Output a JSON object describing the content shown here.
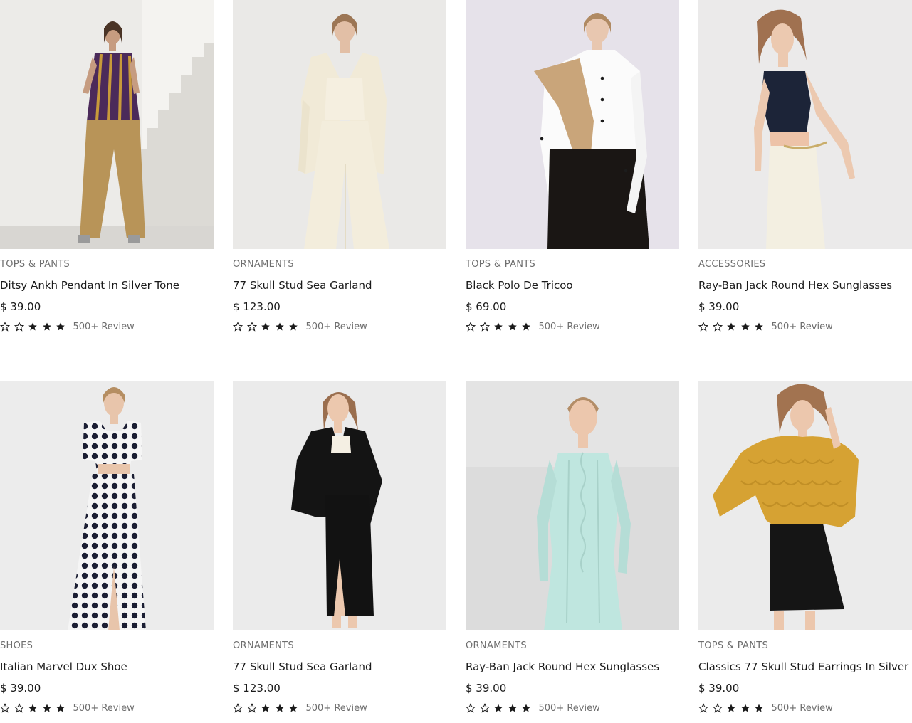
{
  "products": [
    {
      "category": "TOPS & PANTS",
      "title": "Ditsy Ankh Pendant In Silver Tone",
      "price": "$ 39.00",
      "review": "500+ Review",
      "rating": 3,
      "image": "woman-striped-top-gold-trousers-photo"
    },
    {
      "category": "ORNAMENTS",
      "title": "77 Skull Stud Sea Garland",
      "price": "$ 123.00",
      "review": "500+ Review",
      "rating": 3,
      "image": "woman-cream-suit-photo"
    },
    {
      "category": "TOPS & PANTS",
      "title": "Black Polo De Tricoo",
      "price": "$ 69.00",
      "review": "500+ Review",
      "rating": 3,
      "image": "woman-white-shirt-black-pants-photo"
    },
    {
      "category": "ACCESSORIES",
      "title": "Ray-Ban Jack Round Hex Sunglasses",
      "price": "$ 39.00",
      "review": "500+ Review",
      "rating": 3,
      "image": "woman-navy-crop-top-cream-pants-photo"
    },
    {
      "category": "SHOES",
      "title": "Italian Marvel Dux Shoe",
      "price": "$ 39.00",
      "review": "500+ Review",
      "rating": 3,
      "image": "woman-polka-dot-dress-photo"
    },
    {
      "category": "ORNAMENTS",
      "title": "77 Skull Stud Sea Garland",
      "price": "$ 123.00",
      "review": "500+ Review",
      "rating": 3,
      "image": "woman-black-blazer-skirt-photo"
    },
    {
      "category": "ORNAMENTS",
      "title": "Ray-Ban Jack Round Hex Sunglasses",
      "price": "$ 39.00",
      "review": "500+ Review",
      "rating": 3,
      "image": "woman-mint-knit-dress-photo"
    },
    {
      "category": "TOPS & PANTS",
      "title": "Classics 77 Skull Stud Earrings In Silver",
      "price": "$ 39.00",
      "review": "500+ Review",
      "rating": 3,
      "image": "woman-mustard-sweater-black-skirt-photo"
    }
  ],
  "colors": {
    "text": "#1a1a1a",
    "muted": "#6e6e6e",
    "star": "#1a1a1a"
  }
}
